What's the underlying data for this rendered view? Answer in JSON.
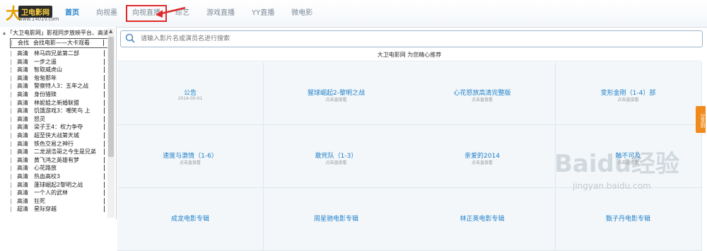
{
  "logo": {
    "big": "大",
    "name": "卫电影网",
    "url": "www.1401v.com"
  },
  "nav": [
    {
      "label": "首页",
      "active": true,
      "boxed": false
    },
    {
      "label": "向视墨",
      "active": false,
      "boxed": false
    },
    {
      "label": "向视直播",
      "active": false,
      "boxed": true
    },
    {
      "label": "综艺",
      "active": false,
      "boxed": false
    },
    {
      "label": "游戏直播",
      "active": false,
      "boxed": false
    },
    {
      "label": "YY直播",
      "active": false,
      "boxed": false
    },
    {
      "label": "微电影",
      "active": false,
      "boxed": false
    }
  ],
  "sidebar": {
    "title": "「大卫电影网」影视同步放映平台、高清、",
    "first_row": {
      "tag": "会找",
      "text": "会找电影——大卡观看"
    },
    "rows": [
      {
        "tag": "高清",
        "text": "林马四兄弟第二部"
      },
      {
        "tag": "高清",
        "text": "一步之遥"
      },
      {
        "tag": "高清",
        "text": "智取威虎山"
      },
      {
        "tag": "高清",
        "text": "匆匆那年"
      },
      {
        "tag": "高清",
        "text": "警察特人3：五年之战"
      },
      {
        "tag": "高清",
        "text": "身份猎赎"
      },
      {
        "tag": "高清",
        "text": "林妮姐之新婚联盟"
      },
      {
        "tag": "高清",
        "text": "饥饿游戏3：嘲笑鸟 上"
      },
      {
        "tag": "高清",
        "text": "怒灵"
      },
      {
        "tag": "高清",
        "text": "梁子王4：权力争夺"
      },
      {
        "tag": "高清",
        "text": "超至侠大战第天城"
      },
      {
        "tag": "高清",
        "text": "铁色交易之神行"
      },
      {
        "tag": "高清",
        "text": "二龙湖浩哥之今生是兄弟"
      },
      {
        "tag": "高清",
        "text": "黄飞鸿之英雄有梦"
      },
      {
        "tag": "高清",
        "text": "心花路放"
      },
      {
        "tag": "高清",
        "text": "热血高校3"
      },
      {
        "tag": "高清",
        "text": "蓬球崛起2黎明之战"
      },
      {
        "tag": "高清",
        "text": "一个人的武林"
      },
      {
        "tag": "高清",
        "text": "狂死"
      },
      {
        "tag": "超清",
        "text": "星际穿越"
      }
    ]
  },
  "search": {
    "placeholder": "请输入影片名或演员名进行搜索"
  },
  "recommend_text": "大卫电影网 为您精心推荐",
  "cells": [
    {
      "title": "公告",
      "sub": "2014-00-01"
    },
    {
      "title": "猩球崛起2-黎明之战",
      "sub": "点击直接看"
    },
    {
      "title": "心花怒放高清完整版",
      "sub": "点击直接看"
    },
    {
      "title": "变形金刚（1-4）部",
      "sub": "点击直接看"
    },
    {
      "title": "速度与激情（1-6）",
      "sub": "点击直接看"
    },
    {
      "title": "敢死队（1-3）",
      "sub": "点击直接看"
    },
    {
      "title": "亲爱的2014",
      "sub": "点击直接看"
    },
    {
      "title": "触不可及",
      "sub": "点击直接看"
    },
    {
      "title": "成龙电影专辑",
      "sub": ""
    },
    {
      "title": "周星驰电影专辑",
      "sub": ""
    },
    {
      "title": "林正英电影专辑",
      "sub": ""
    },
    {
      "title": "甄子丹电影专辑",
      "sub": ""
    }
  ],
  "share": "分享到",
  "watermark": {
    "brand": "Baidu经验",
    "url": "jingyan.baidu.com"
  }
}
